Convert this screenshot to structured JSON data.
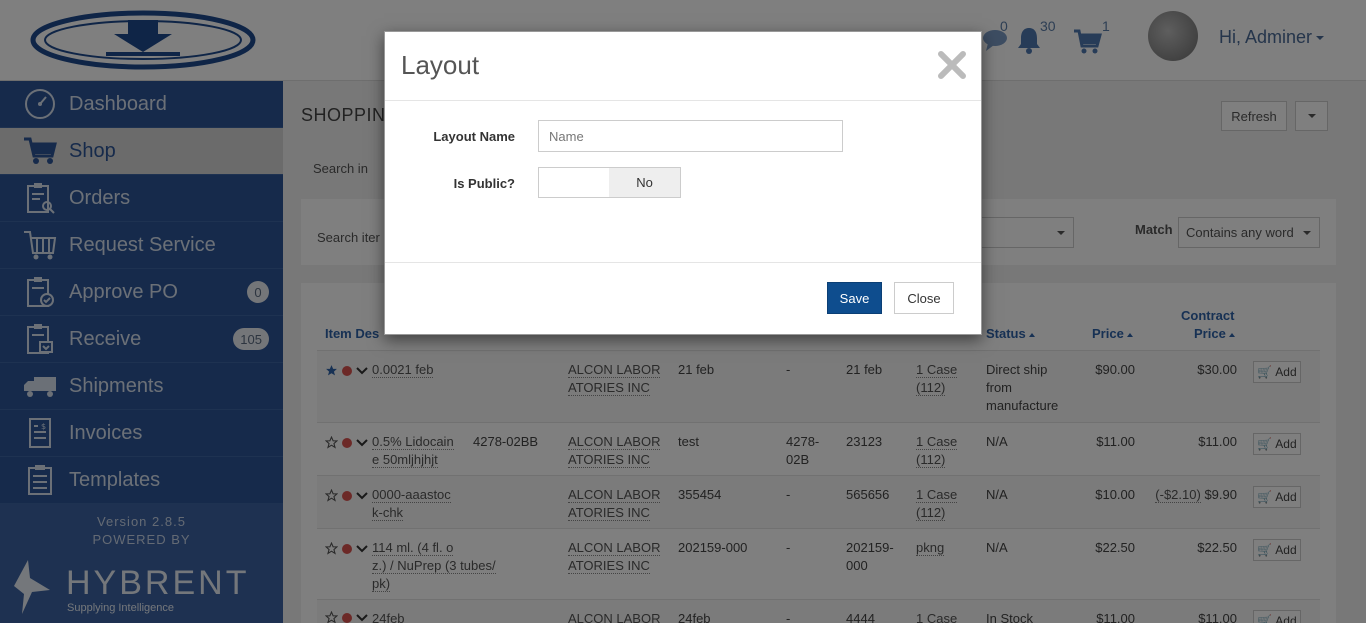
{
  "header": {
    "greeting": "Hi, Adminer",
    "messages_count": "0",
    "notifications_count": "30",
    "cart_count": "1"
  },
  "sidebar": {
    "items": [
      {
        "label": "Dashboard",
        "icon": "dashboard-icon",
        "badge": ""
      },
      {
        "label": "Shop",
        "icon": "cart-icon",
        "badge": ""
      },
      {
        "label": "Orders",
        "icon": "orders-icon",
        "badge": ""
      },
      {
        "label": "Request Service",
        "icon": "request-service-icon",
        "badge": ""
      },
      {
        "label": "Approve PO",
        "icon": "approve-icon",
        "badge": "0"
      },
      {
        "label": "Receive",
        "icon": "receive-icon",
        "badge": "105"
      },
      {
        "label": "Shipments",
        "icon": "truck-icon",
        "badge": ""
      },
      {
        "label": "Invoices",
        "icon": "invoice-icon",
        "badge": ""
      },
      {
        "label": "Templates",
        "icon": "templates-icon",
        "badge": ""
      }
    ],
    "version_line": "Version 2.8.5",
    "powered_by": "POWERED BY",
    "brand": "HYBRENT",
    "tagline": "Supplying Intelligence"
  },
  "main": {
    "title": "SHOPPING",
    "refresh_label": "Refresh",
    "search_in_label": "Search in",
    "search_items_label": "Search iter",
    "match_label": "Match",
    "match_value": "Contains any word"
  },
  "table": {
    "headers": {
      "item_desc": "Item Des",
      "status": "Status",
      "price": "Price",
      "contract_price_1": "Contract",
      "contract_price_2": "Price"
    },
    "add_label": "Add",
    "rows": [
      {
        "desc1": "0.0021 feb",
        "desc2": "",
        "desc3": "",
        "sku": "",
        "vendor1": "ALCON LABOR",
        "vendor2": "ATORIES INC",
        "mfr": "21 feb",
        "mfr_no": "-",
        "mfr_no2": "",
        "sku2": "21 feb",
        "sku2b": "",
        "uom1": "1 Case",
        "uom2": "(112)",
        "status1": "Direct ship",
        "status2": "from",
        "status3": "manufacture",
        "price": "$90.00",
        "contract_adj": "",
        "contract": "$30.00",
        "starred": true
      },
      {
        "desc1": "0.5% Lidocain",
        "desc2": "e 50mljhjhjt",
        "desc3": "",
        "sku": "4278-02BB",
        "vendor1": "ALCON LABOR",
        "vendor2": "ATORIES INC",
        "mfr": "test",
        "mfr_no": "4278-",
        "mfr_no2": "02B",
        "sku2": "23123",
        "sku2b": "",
        "uom1": "1 Case",
        "uom2": "(112)",
        "status1": "N/A",
        "status2": "",
        "status3": "",
        "price": "$11.00",
        "contract_adj": "",
        "contract": "$11.00",
        "starred": false
      },
      {
        "desc1": "0000-aaastoc",
        "desc2": "k-chk",
        "desc3": "",
        "sku": "",
        "vendor1": "ALCON LABOR",
        "vendor2": "ATORIES INC",
        "mfr": "355454",
        "mfr_no": "-",
        "mfr_no2": "",
        "sku2": "565656",
        "sku2b": "",
        "uom1": "1 Case",
        "uom2": "(112)",
        "status1": "N/A",
        "status2": "",
        "status3": "",
        "price": "$10.00",
        "contract_adj": "(-$2.10)",
        "contract": "$9.90",
        "starred": false
      },
      {
        "desc1": "114 ml. (4 fl. o",
        "desc2": "z.) / NuPrep (3 tubes/",
        "desc3": "pk)",
        "sku": "",
        "vendor1": "ALCON LABOR",
        "vendor2": "ATORIES INC",
        "mfr": "202159-000",
        "mfr_no": "-",
        "mfr_no2": "",
        "sku2": "202159-",
        "sku2b": "000",
        "uom1": "pkng",
        "uom2": "",
        "status1": "N/A",
        "status2": "",
        "status3": "",
        "price": "$22.50",
        "contract_adj": "",
        "contract": "$22.50",
        "starred": false
      },
      {
        "desc1": "24feb",
        "desc2": "",
        "desc3": "",
        "sku": "",
        "vendor1": "ALCON LABOR",
        "vendor2": "",
        "mfr": "24feb",
        "mfr_no": "-",
        "mfr_no2": "",
        "sku2": "4444",
        "sku2b": "",
        "uom1": "1 Case",
        "uom2": "",
        "status1": "In Stock",
        "status2": "",
        "status3": "",
        "price": "$11.00",
        "contract_adj": "",
        "contract": "$11.00",
        "starred": false
      }
    ]
  },
  "modal": {
    "title": "Layout",
    "layout_name_label": "Layout Name",
    "layout_name_placeholder": "Name",
    "layout_name_value": "",
    "is_public_label": "Is Public?",
    "is_public_value": "No",
    "save_label": "Save",
    "close_label": "Close"
  },
  "colors": {
    "sidebar_bg": "#2d5596",
    "accent": "#0e4d8e",
    "link": "#2f63a8"
  }
}
